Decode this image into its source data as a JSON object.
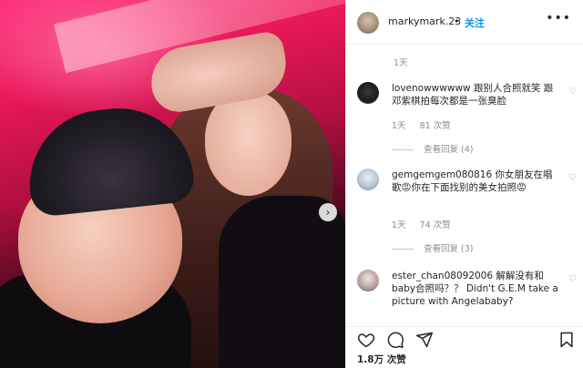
{
  "post": {
    "username": "markymark.23",
    "separator": "•",
    "follow_label": "关注",
    "more_icon": "more-icon",
    "posted_time": "1天",
    "likes_text": "1.8万 次赞"
  },
  "comments": [
    {
      "username": "lovenowwwwww",
      "text": "跟别人合照就笑 跟邓紫棋拍每次都是一张臭脸",
      "time": "1天",
      "likes": "81 次赞",
      "view_replies": "查看回复 (4)"
    },
    {
      "username": "gemgemgem080816",
      "text": "你女朋友在唱歌😡你在下面找别的美女拍照😡",
      "time": "1天",
      "likes": "74 次赞",
      "view_replies": "查看回复 (3)"
    },
    {
      "username": "ester_chan08092006",
      "text": "解解没有和baby合照吗？？ Didn't G.E.M take a picture with Angelababy?"
    }
  ],
  "icons": {
    "heart": "heart-icon",
    "comment": "comment-icon",
    "share": "share-icon",
    "save": "bookmark-icon",
    "next": "chevron-right-icon"
  },
  "colors": {
    "accent": "#0095f6",
    "muted": "#8e8e8e",
    "text": "#262626"
  }
}
